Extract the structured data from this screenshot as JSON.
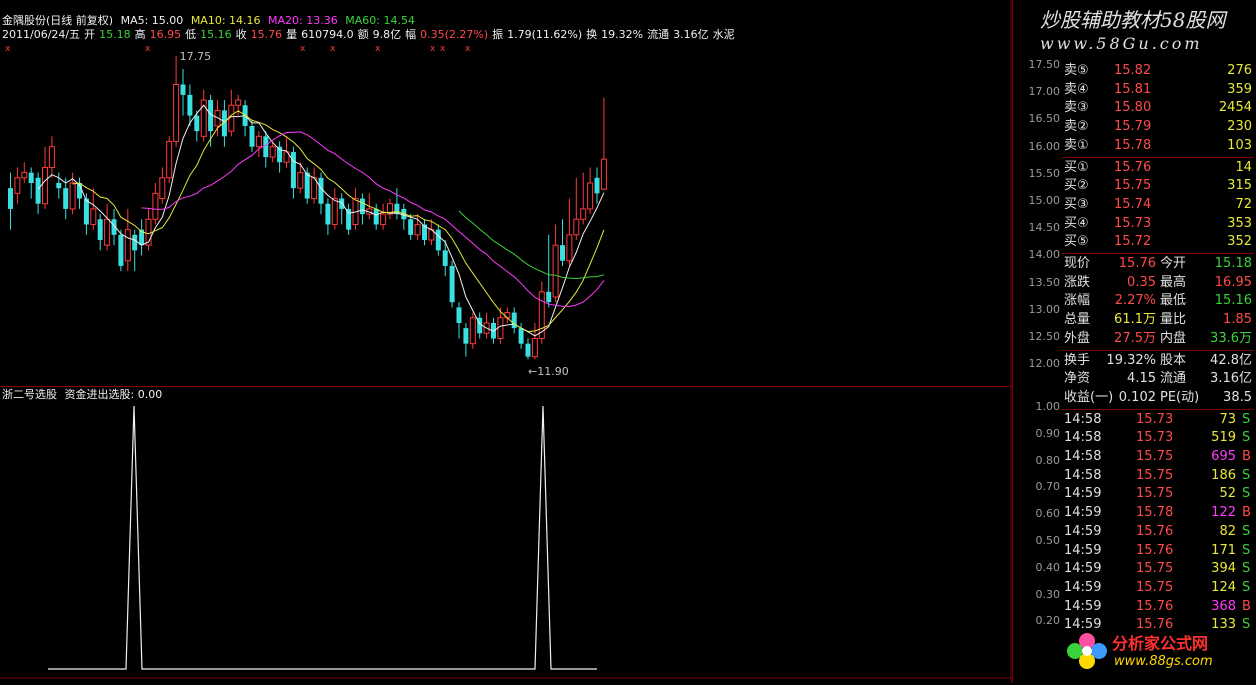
{
  "header": {
    "stock": "金隅股份(日线 前复权)",
    "ma5": "MA5: 15.00",
    "ma10": "MA10: 14.16",
    "ma20": "MA20: 13.36",
    "ma60": "MA60: 14.54",
    "date": "2011/06/24/五",
    "open_label": "开",
    "open": "15.18",
    "high_label": "高",
    "high": "16.95",
    "low_label": "低",
    "low": "15.16",
    "close_label": "收",
    "close": "15.76",
    "vol_label": "量",
    "vol": "610794.0",
    "amt_label": "额",
    "amt": "9.8亿",
    "chg_label": "幅",
    "chg": "0.35(2.27%)",
    "amp_label": "振",
    "amp": "1.79(11.62%)",
    "turn_label": "换",
    "turn": "19.32%",
    "float_label": "流通",
    "float": "3.16亿",
    "sector": "水泥"
  },
  "annotations": {
    "high_mark": "17.75",
    "low_mark": "←11.90"
  },
  "indicator": {
    "title": "浙二号选股",
    "formula": "资金进出选股: 0.00"
  },
  "price_ticks": [
    "17.50",
    "17.00",
    "16.50",
    "16.00",
    "15.50",
    "15.00",
    "14.50",
    "14.00",
    "13.50",
    "13.00",
    "12.50",
    "12.00"
  ],
  "ind_ticks": [
    "1.00",
    "0.90",
    "0.80",
    "0.70",
    "0.60",
    "0.50",
    "0.40",
    "0.30",
    "0.20"
  ],
  "logo": {
    "text": "炒股辅助教材58股网",
    "url": "www.58Gu.com"
  },
  "watermark": {
    "name": "分析家公式网",
    "url": "www.88gs.com"
  },
  "sell": [
    {
      "label": "卖⑤",
      "price": "15.82",
      "vol": "276"
    },
    {
      "label": "卖④",
      "price": "15.81",
      "vol": "359"
    },
    {
      "label": "卖③",
      "price": "15.80",
      "vol": "2454"
    },
    {
      "label": "卖②",
      "price": "15.79",
      "vol": "230"
    },
    {
      "label": "卖①",
      "price": "15.78",
      "vol": "103"
    }
  ],
  "buy": [
    {
      "label": "买①",
      "price": "15.76",
      "vol": "14"
    },
    {
      "label": "买②",
      "price": "15.75",
      "vol": "315"
    },
    {
      "label": "买③",
      "price": "15.74",
      "vol": "72"
    },
    {
      "label": "买④",
      "price": "15.73",
      "vol": "353"
    },
    {
      "label": "买⑤",
      "price": "15.72",
      "vol": "352"
    }
  ],
  "quote": [
    {
      "l1": "现价",
      "v1": "15.76",
      "l2": "今开",
      "v2": "15.18"
    },
    {
      "l1": "涨跌",
      "v1": "0.35",
      "l2": "最高",
      "v2": "16.95"
    },
    {
      "l1": "涨幅",
      "v1": "2.27%",
      "l2": "最低",
      "v2": "15.16"
    },
    {
      "l1": "总量",
      "v1": "61.1万",
      "l2": "量比",
      "v2": "1.85"
    },
    {
      "l1": "外盘",
      "v1": "27.5万",
      "l2": "内盘",
      "v2": "33.6万"
    }
  ],
  "finance": [
    {
      "l1": "换手",
      "v1": "19.32%",
      "l2": "股本",
      "v2": "42.8亿"
    },
    {
      "l1": "净资",
      "v1": "4.15",
      "l2": "流通",
      "v2": "3.16亿"
    },
    {
      "l1": "收益(一)",
      "v1": "0.102",
      "l2": "PE(动)",
      "v2": "38.5"
    }
  ],
  "ticks": [
    {
      "t": "14:58",
      "p": "15.73",
      "v": "73",
      "s": "S"
    },
    {
      "t": "14:58",
      "p": "15.73",
      "v": "519",
      "s": "S"
    },
    {
      "t": "14:58",
      "p": "15.75",
      "v": "695",
      "s": "B"
    },
    {
      "t": "14:58",
      "p": "15.75",
      "v": "186",
      "s": "S"
    },
    {
      "t": "14:59",
      "p": "15.75",
      "v": "52",
      "s": "S"
    },
    {
      "t": "14:59",
      "p": "15.78",
      "v": "122",
      "s": "B"
    },
    {
      "t": "14:59",
      "p": "15.76",
      "v": "82",
      "s": "S"
    },
    {
      "t": "14:59",
      "p": "15.76",
      "v": "171",
      "s": "S"
    },
    {
      "t": "14:59",
      "p": "15.75",
      "v": "394",
      "s": "S"
    },
    {
      "t": "14:59",
      "p": "15.75",
      "v": "124",
      "s": "S"
    },
    {
      "t": "14:59",
      "p": "15.76",
      "v": "368",
      "s": "B"
    },
    {
      "t": "14:59",
      "p": "15.76",
      "v": "133",
      "s": "S"
    }
  ],
  "chart_data": {
    "type": "candlestick",
    "ylim": [
      11.75,
      17.75
    ],
    "candles": [
      [
        15.2,
        14.8,
        15.5,
        14.4
      ],
      [
        15.1,
        15.4,
        15.6,
        14.9
      ],
      [
        15.4,
        15.5,
        15.7,
        15.3
      ],
      [
        15.5,
        15.3,
        15.6,
        15.0
      ],
      [
        15.4,
        14.9,
        15.5,
        14.7
      ],
      [
        14.9,
        15.6,
        16.0,
        14.8
      ],
      [
        15.6,
        16.0,
        16.2,
        15.4
      ],
      [
        15.3,
        15.2,
        15.5,
        15.0
      ],
      [
        15.2,
        14.8,
        15.4,
        14.6
      ],
      [
        14.8,
        15.3,
        15.5,
        14.7
      ],
      [
        15.3,
        15.0,
        15.4,
        14.8
      ],
      [
        15.0,
        14.5,
        15.1,
        14.3
      ],
      [
        14.5,
        14.8,
        15.2,
        14.4
      ],
      [
        14.6,
        14.2,
        14.7,
        14.0
      ],
      [
        14.1,
        14.6,
        14.9,
        14.0
      ],
      [
        14.6,
        14.3,
        14.8,
        14.1
      ],
      [
        14.3,
        13.7,
        14.4,
        13.6
      ],
      [
        13.8,
        14.4,
        14.8,
        13.6
      ],
      [
        14.3,
        14.0,
        14.4,
        13.6
      ],
      [
        14.4,
        14.1,
        14.6,
        13.9
      ],
      [
        14.1,
        14.6,
        14.8,
        14.0
      ],
      [
        14.6,
        15.1,
        15.3,
        14.5
      ],
      [
        15.0,
        15.4,
        15.6,
        14.9
      ],
      [
        15.4,
        16.1,
        16.2,
        15.3
      ],
      [
        16.1,
        17.2,
        17.75,
        16.0
      ],
      [
        17.2,
        17.0,
        17.5,
        16.6
      ],
      [
        17.0,
        16.6,
        17.2,
        16.4
      ],
      [
        16.6,
        16.3,
        16.7,
        16.1
      ],
      [
        16.2,
        16.9,
        17.1,
        16.1
      ],
      [
        16.9,
        16.3,
        17.0,
        16.0
      ],
      [
        16.4,
        16.7,
        16.9,
        16.2
      ],
      [
        16.7,
        16.2,
        16.9,
        16.0
      ],
      [
        16.3,
        16.8,
        17.1,
        16.2
      ],
      [
        16.8,
        16.9,
        17.0,
        16.6
      ],
      [
        16.8,
        16.4,
        16.9,
        16.2
      ],
      [
        16.4,
        16.0,
        16.5,
        15.9
      ],
      [
        16.0,
        16.2,
        16.3,
        15.8
      ],
      [
        16.2,
        15.8,
        16.3,
        15.6
      ],
      [
        15.8,
        16.0,
        16.1,
        15.7
      ],
      [
        16.0,
        15.7,
        16.1,
        15.5
      ],
      [
        15.7,
        15.9,
        16.2,
        15.6
      ],
      [
        15.9,
        15.2,
        16.0,
        15.0
      ],
      [
        15.2,
        15.5,
        15.7,
        15.1
      ],
      [
        15.5,
        15.0,
        15.6,
        14.9
      ],
      [
        15.0,
        15.4,
        15.6,
        14.9
      ],
      [
        15.4,
        14.9,
        15.5,
        14.7
      ],
      [
        14.9,
        14.5,
        15.0,
        14.3
      ],
      [
        14.5,
        15.0,
        15.2,
        14.4
      ],
      [
        15.0,
        14.8,
        15.1,
        14.5
      ],
      [
        14.8,
        14.4,
        14.9,
        14.3
      ],
      [
        14.5,
        15.0,
        15.2,
        14.4
      ],
      [
        15.0,
        14.7,
        15.1,
        14.5
      ],
      [
        14.7,
        14.8,
        15.1,
        14.6
      ],
      [
        14.8,
        14.5,
        14.9,
        14.4
      ],
      [
        14.5,
        14.7,
        14.9,
        14.4
      ],
      [
        14.7,
        14.9,
        15.0,
        14.6
      ],
      [
        14.9,
        14.7,
        15.2,
        14.6
      ],
      [
        14.8,
        14.6,
        14.9,
        14.4
      ],
      [
        14.6,
        14.3,
        14.7,
        14.2
      ],
      [
        14.3,
        14.5,
        14.7,
        14.2
      ],
      [
        14.5,
        14.2,
        14.6,
        14.1
      ],
      [
        14.2,
        14.4,
        14.6,
        14.1
      ],
      [
        14.4,
        14.0,
        14.5,
        13.9
      ],
      [
        14.0,
        13.7,
        14.2,
        13.5
      ],
      [
        13.7,
        13.0,
        13.8,
        12.9
      ],
      [
        12.9,
        12.6,
        13.0,
        12.3
      ],
      [
        12.5,
        12.2,
        12.6,
        11.95
      ],
      [
        12.2,
        12.7,
        12.8,
        12.1
      ],
      [
        12.7,
        12.4,
        12.8,
        12.3
      ],
      [
        12.4,
        12.6,
        12.8,
        12.3
      ],
      [
        12.6,
        12.3,
        12.7,
        12.2
      ],
      [
        12.3,
        12.7,
        12.9,
        12.2
      ],
      [
        12.7,
        12.8,
        12.9,
        12.6
      ],
      [
        12.8,
        12.5,
        12.9,
        12.4
      ],
      [
        12.5,
        12.2,
        12.6,
        12.1
      ],
      [
        12.2,
        11.95,
        12.3,
        11.9
      ],
      [
        11.95,
        12.3,
        12.6,
        11.9
      ],
      [
        12.3,
        13.2,
        13.4,
        12.2
      ],
      [
        13.2,
        13.0,
        14.3,
        12.9
      ],
      [
        13.1,
        14.1,
        14.5,
        13.0
      ],
      [
        14.1,
        13.8,
        14.6,
        13.7
      ],
      [
        13.8,
        14.3,
        15.0,
        13.7
      ],
      [
        14.3,
        14.6,
        15.4,
        14.2
      ],
      [
        14.6,
        14.8,
        15.5,
        14.5
      ],
      [
        14.8,
        15.3,
        15.6,
        14.7
      ],
      [
        15.4,
        15.1,
        15.6,
        14.9
      ],
      [
        15.18,
        15.76,
        16.95,
        15.16
      ]
    ],
    "series": [
      {
        "name": "MA5",
        "color": "#f0f0f0",
        "from": 4,
        "values": []
      },
      {
        "name": "MA10",
        "color": "#e8e83a",
        "from": 9,
        "values": []
      },
      {
        "name": "MA20",
        "color": "#ff3aff",
        "from": 19,
        "values": []
      },
      {
        "name": "MA60",
        "color": "#3ad23a",
        "from": 59,
        "values": []
      }
    ],
    "indicator": {
      "ylim": [
        0,
        1
      ],
      "signals": [
        15,
        75
      ]
    }
  }
}
